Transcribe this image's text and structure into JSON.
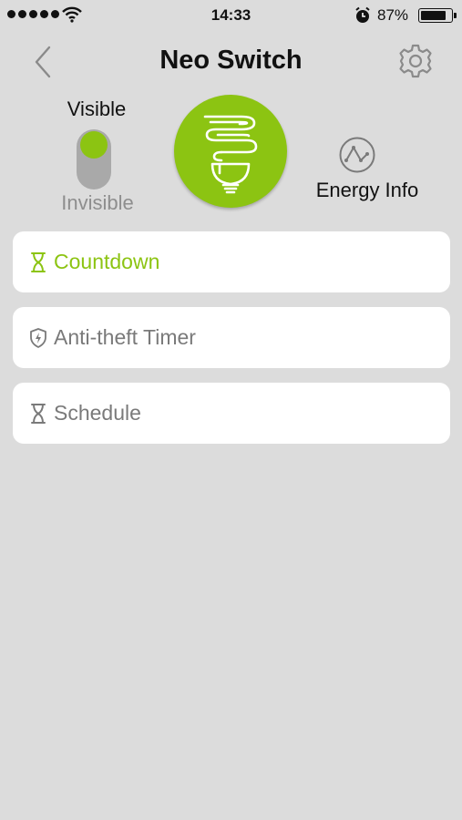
{
  "status_bar": {
    "time": "14:33",
    "battery_percent": "87%",
    "battery_level": 0.87
  },
  "nav": {
    "title": "Neo Switch",
    "back_icon": "chevron-left-icon",
    "settings_icon": "gear-icon"
  },
  "visibility": {
    "on_label": "Visible",
    "off_label": "Invisible",
    "state": "Visible"
  },
  "power": {
    "icon": "light-bulb-icon",
    "state": "on",
    "accent_color": "#8cc412"
  },
  "energy": {
    "label": "Energy Info",
    "icon": "graph-icon"
  },
  "menu": [
    {
      "label": "Countdown",
      "icon": "hourglass-icon",
      "active": true
    },
    {
      "label": "Anti-theft Timer",
      "icon": "shield-bolt-icon",
      "active": false
    },
    {
      "label": "Schedule",
      "icon": "hourglass-icon",
      "active": false
    }
  ],
  "colors": {
    "accent": "#8cc412",
    "background": "#dcdcdc",
    "card": "#ffffff",
    "muted_text": "#7a7a7a"
  }
}
